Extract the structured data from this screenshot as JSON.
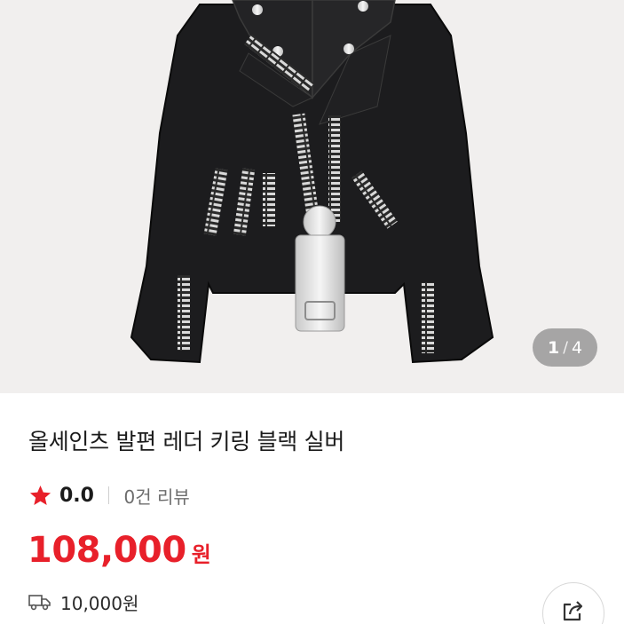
{
  "gallery": {
    "image_alt": "leather jacket keyring",
    "current": "1",
    "separator": "/",
    "total": "4"
  },
  "product": {
    "title": "올세인츠 발편 레더 키링 블랙 실버",
    "rating": "0.0",
    "reviews": "0건 리뷰",
    "price": "108,000",
    "price_unit": "원",
    "shipping_fee": "10,000원"
  },
  "icons": {
    "rating": "star-icon",
    "shipping": "truck-icon",
    "share": "share-icon"
  },
  "colors": {
    "accent": "#e8202a",
    "hero_background": "#f1efee",
    "jacket": "#1c1c1e"
  }
}
